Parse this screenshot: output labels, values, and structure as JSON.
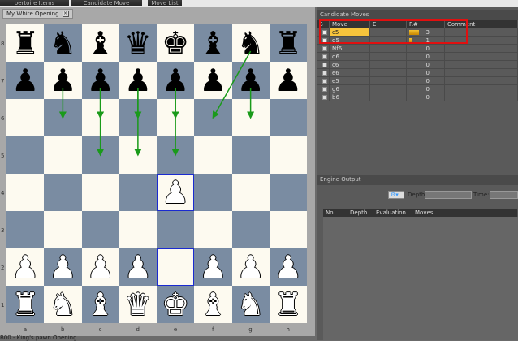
{
  "top_tabs": [
    "pertoire Items",
    "Candidate Move",
    "Move List"
  ],
  "document_tab": "My White Opening",
  "board": {
    "ranks": [
      "8",
      "7",
      "6",
      "5",
      "4",
      "3",
      "2",
      "1"
    ],
    "files": [
      "a",
      "b",
      "c",
      "d",
      "e",
      "f",
      "g",
      "h"
    ],
    "position": [
      [
        "br",
        "bn",
        "bb",
        "bq",
        "bk",
        "bb",
        "bn",
        "br"
      ],
      [
        "bp",
        "bp",
        "bp",
        "bp",
        "bp",
        "bp",
        "bp",
        "bp"
      ],
      [
        "",
        "",
        "",
        "",
        "",
        "",
        "",
        ""
      ],
      [
        "",
        "",
        "",
        "",
        "",
        "",
        "",
        ""
      ],
      [
        "",
        "",
        "",
        "",
        "wp",
        "",
        "",
        ""
      ],
      [
        "",
        "",
        "",
        "",
        "",
        "",
        "",
        ""
      ],
      [
        "wp",
        "wp",
        "wp",
        "wp",
        "",
        "wp",
        "wp",
        "wp"
      ],
      [
        "wr",
        "wn",
        "wb",
        "wq",
        "wk",
        "wb",
        "wn",
        "wr"
      ]
    ],
    "highlighted": [
      "e4",
      "e2"
    ],
    "arrows": [
      [
        "b7",
        "b6"
      ],
      [
        "c7",
        "c5"
      ],
      [
        "c7",
        "c6"
      ],
      [
        "d7",
        "d5"
      ],
      [
        "d7",
        "d6"
      ],
      [
        "e7",
        "e5"
      ],
      [
        "e7",
        "e6"
      ],
      [
        "g8",
        "f6"
      ],
      [
        "g7",
        "g6"
      ]
    ],
    "arrow_color": "#1a9a1a"
  },
  "status_text": "B00 - King's pawn Opening",
  "candidate_moves": {
    "title": "Candidate Moves",
    "columns": [
      "B",
      "Move",
      "E",
      "R#",
      "Comment"
    ],
    "rows": [
      {
        "move": "c5",
        "count": "3",
        "bar": 1.0,
        "selected": true,
        "checked": true
      },
      {
        "move": "d5",
        "count": "1",
        "bar": 0.33,
        "checked": true
      },
      {
        "move": "Nf6",
        "count": "0"
      },
      {
        "move": "d6",
        "count": "0"
      },
      {
        "move": "c6",
        "count": "0"
      },
      {
        "move": "e6",
        "count": "0"
      },
      {
        "move": "e5",
        "count": "0"
      },
      {
        "move": "g6",
        "count": "0"
      },
      {
        "move": "b6",
        "count": "0"
      }
    ]
  },
  "engine_output": {
    "title": "Engine Output",
    "depth_label": "Depth:",
    "time_label": "Time:",
    "columns": [
      "No.",
      "Depth",
      "Evaluation",
      "Moves"
    ]
  }
}
